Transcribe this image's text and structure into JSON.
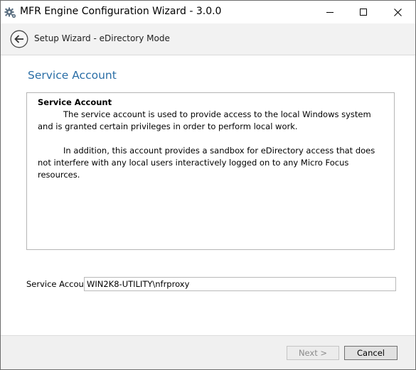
{
  "window": {
    "title": "MFR Engine Configuration Wizard - 3.0.0",
    "icon": "gear-icon",
    "controls": [
      "minimize-icon",
      "maximize-icon",
      "close-icon"
    ]
  },
  "nav": {
    "back_icon": "back-arrow-icon",
    "title": "Setup Wizard - eDirectory Mode"
  },
  "page": {
    "title": "Service Account"
  },
  "info": {
    "heading": "Service Account",
    "paragraph1": "The service account is used to provide access to the local Windows system and is granted certain privileges in order to perform local work.",
    "paragraph2": "In addition, this account provides a sandbox for eDirectory access that does not interfere with any local users interactively logged on to any Micro Focus resources."
  },
  "form": {
    "service_account_label": "Service Account",
    "service_account_value": "WIN2K8-UTILITY\\nfrproxy"
  },
  "footer": {
    "next_label": "Next >",
    "cancel_label": "Cancel"
  },
  "colors": {
    "accent": "#2a6ea6",
    "nav_background": "#f2f2f2",
    "footer_background": "#f0f0f0"
  }
}
